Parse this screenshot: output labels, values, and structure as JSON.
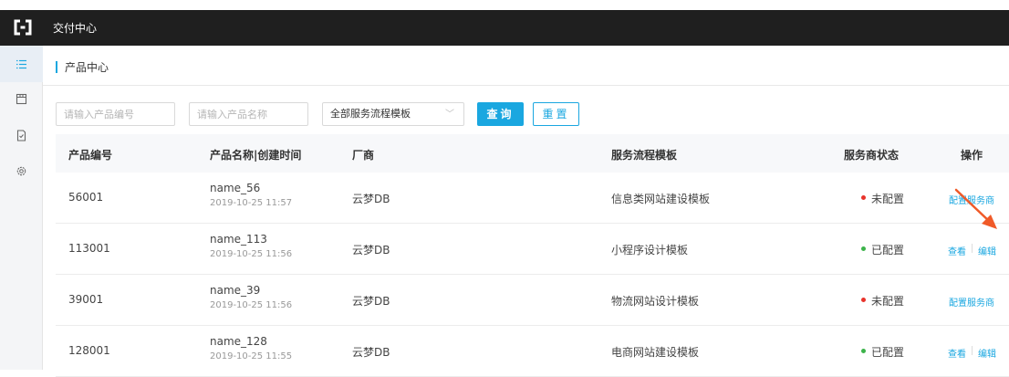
{
  "app": {
    "title": "交付中心",
    "logo_icon": "bracket-logo-icon"
  },
  "sidebar": {
    "items": [
      {
        "icon": "list-icon",
        "active": true
      },
      {
        "icon": "box-icon",
        "active": false
      },
      {
        "icon": "document-icon",
        "active": false
      },
      {
        "icon": "gear-icon",
        "active": false
      }
    ]
  },
  "breadcrumb": {
    "label": "产品中心"
  },
  "filters": {
    "product_no_placeholder": "请输入产品编号",
    "product_name_placeholder": "请输入产品名称",
    "template_select_value": "全部服务流程模板",
    "query_label": "查询",
    "reset_label": "重置"
  },
  "table": {
    "columns": {
      "product_no": "产品编号",
      "name_time": "产品名称|创建时间",
      "vendor": "厂商",
      "template": "服务流程模板",
      "status": "服务商状态",
      "actions": "操作"
    },
    "rows": [
      {
        "no": "56001",
        "name": "name_56",
        "time": "2019-10-25 11:57",
        "vendor": "云梦DB",
        "template": "信息类网站建设模板",
        "status": "未配置",
        "status_color": "#e8332b",
        "ops": [
          "配置服务商"
        ]
      },
      {
        "no": "113001",
        "name": "name_113",
        "time": "2019-10-25 11:56",
        "vendor": "云梦DB",
        "template": "小程序设计模板",
        "status": "已配置",
        "status_color": "#3cb34a",
        "ops": [
          "查看",
          "编辑"
        ]
      },
      {
        "no": "39001",
        "name": "name_39",
        "time": "2019-10-25 11:56",
        "vendor": "云梦DB",
        "template": "物流网站设计模板",
        "status": "未配置",
        "status_color": "#e8332b",
        "ops": [
          "配置服务商"
        ]
      },
      {
        "no": "128001",
        "name": "name_128",
        "time": "2019-10-25 11:55",
        "vendor": "云梦DB",
        "template": "电商网站建设模板",
        "status": "已配置",
        "status_color": "#3cb34a",
        "ops": [
          "查看",
          "编辑"
        ]
      }
    ]
  },
  "colors": {
    "accent": "#1aa7e0",
    "topbar": "#1f1f1f",
    "annotation_arrow": "#f05a28"
  }
}
